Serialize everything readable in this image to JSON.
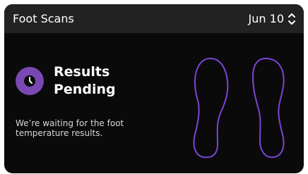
{
  "header": {
    "title": "Foot Scans",
    "date": "Jun 10"
  },
  "status": {
    "line1": "Results",
    "line2": "Pending",
    "icon": "clock-icon",
    "icon_color": "#7a48b3"
  },
  "description": {
    "line1": "We’re waiting for the foot",
    "line2": "temperature results."
  },
  "colors": {
    "card_background": "#0a0a0a",
    "header_background": "#222222",
    "foot_outline": "#7b44d6"
  }
}
